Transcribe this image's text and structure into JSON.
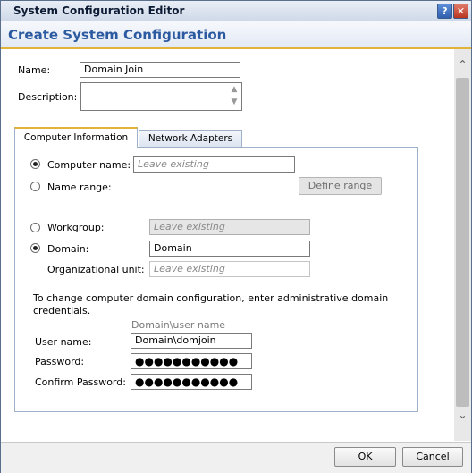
{
  "window": {
    "title": "System Configuration Editor",
    "help_glyph": "?",
    "close_glyph": "✕"
  },
  "header": {
    "title": "Create System Configuration"
  },
  "form": {
    "name_label": "Name:",
    "name_value": "Domain Join",
    "description_label": "Description:",
    "description_value": ""
  },
  "tabs": [
    {
      "label": "Computer Information",
      "active": true
    },
    {
      "label": "Network Adapters",
      "active": false
    }
  ],
  "computer": {
    "computer_name_label": "Computer name:",
    "computer_name_placeholder": "Leave existing",
    "computer_name_selected": true,
    "name_range_label": "Name range:",
    "define_range_label": "Define range",
    "workgroup_label": "Workgroup:",
    "workgroup_placeholder": "Leave existing",
    "domain_label": "Domain:",
    "domain_value": "Domain",
    "domain_selected": true,
    "ou_label": "Organizational unit:",
    "ou_placeholder": "Leave existing",
    "credentials_note": "To change computer domain configuration, enter administrative domain credentials.",
    "username_hint": "Domain\\user name",
    "username_label": "User name:",
    "username_value": "Domain\\domjoin",
    "password_label": "Password:",
    "password_value": "●●●●●●●●●●●",
    "confirm_label": "Confirm Password:",
    "confirm_value": "●●●●●●●●●●●"
  },
  "footer": {
    "ok_label": "OK",
    "cancel_label": "Cancel"
  },
  "colors": {
    "accent": "#2c5aa0",
    "tab_highlight": "#e2b33a",
    "border": "#9fb1c9"
  }
}
